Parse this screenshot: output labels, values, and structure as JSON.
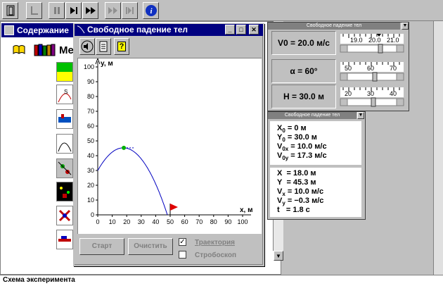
{
  "toolbar": {
    "buttons": [
      "exit-icon",
      "step-back-icon",
      "pause-icon",
      "step-forward-icon",
      "fast-forward-icon",
      "disabled-step-icon",
      "disabled-steps-icon",
      "info-icon"
    ]
  },
  "help": {
    "title": "Содержание",
    "first_item": "Ме"
  },
  "main": {
    "title": "Свободное падение тел",
    "help_btn": "?",
    "start_label": "Старт",
    "clear_label": "Очистить",
    "trajectory_label": "Траектория",
    "stroboscope_label": "Стробоскоп",
    "trajectory_checked": true,
    "stroboscope_checked": false
  },
  "params": {
    "title": "Свободное падение тел",
    "v0_label": "V0 = 20.0 м/с",
    "v0_ticks": [
      "19.0",
      "20.0",
      "21.0"
    ],
    "alpha_label": "α = 60°",
    "alpha_ticks": [
      "50",
      "60",
      "70"
    ],
    "h_label": "H = 30.0 м",
    "h_ticks": [
      "20",
      "30",
      "40"
    ]
  },
  "results": {
    "title": "Свободное падение тел",
    "group1": [
      {
        "sym": "X",
        "sub": "0",
        "val": " = 0 м"
      },
      {
        "sym": "Y",
        "sub": "0",
        "val": " = 30.0 м"
      },
      {
        "sym": "V",
        "sub": "0x",
        "val": " = 10.0 м/с"
      },
      {
        "sym": "V",
        "sub": "0y",
        "val": " = 17.3 м/с"
      }
    ],
    "group2": [
      {
        "sym": "X",
        "sub": "",
        "val": "  = 18.0 м"
      },
      {
        "sym": "Y",
        "sub": "",
        "val": "  = 45.3 м"
      },
      {
        "sym": "V",
        "sub": "x",
        "val": " = 10.0 м/с"
      },
      {
        "sym": "V",
        "sub": "y",
        "val": " = −0.3 м/с"
      },
      {
        "sym": "t",
        "sub": "",
        "val": "   = 1.8 с"
      }
    ]
  },
  "status": {
    "text": "Схема эксперимента"
  },
  "chart_data": {
    "type": "line",
    "xlabel": "x, м",
    "ylabel": "y, м",
    "xlim": [
      0,
      100
    ],
    "ylim": [
      0,
      100
    ],
    "x_ticks": [
      0,
      10,
      20,
      30,
      40,
      50,
      60,
      70,
      80,
      90,
      100
    ],
    "y_ticks": [
      0,
      10,
      20,
      30,
      40,
      50,
      60,
      70,
      80,
      90,
      100
    ],
    "v0": 20.0,
    "angle_deg": 60,
    "h0": 30.0,
    "current_point": {
      "x": 18.0,
      "y": 45.3
    },
    "target_flag_x": 50
  }
}
